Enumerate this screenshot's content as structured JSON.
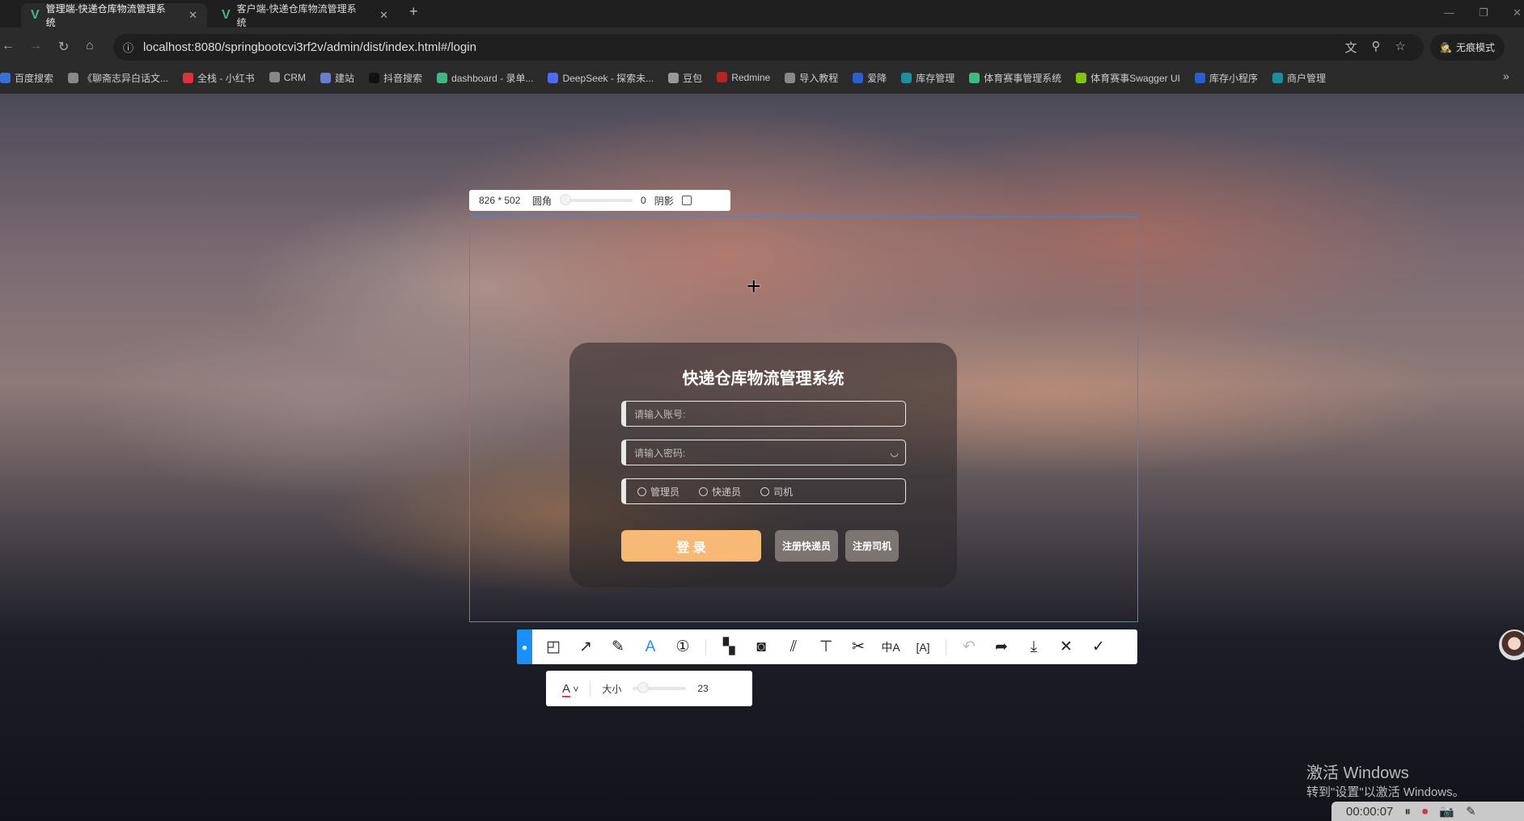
{
  "browser": {
    "tabs": [
      {
        "title": "管理端-快递仓库物流管理系统",
        "active": true
      },
      {
        "title": "客户端-快递仓库物流管理系统",
        "active": false
      }
    ],
    "url": "localhost:8080/springbootcvi3rf2v/admin/dist/index.html#/login",
    "incognito": "无痕模式",
    "bookmarks": [
      {
        "label": "百度搜索",
        "color": "#3b6fd8"
      },
      {
        "label": "《聊斋志异白话文...",
        "color": "#888"
      },
      {
        "label": "全栈 - 小红书",
        "color": "#e0303a"
      },
      {
        "label": "CRM",
        "color": "#888"
      },
      {
        "label": "建站",
        "color": "#6a7bd0"
      },
      {
        "label": "抖音搜索",
        "color": "#111"
      },
      {
        "label": "dashboard - 录单...",
        "color": "#41b883"
      },
      {
        "label": "DeepSeek - 探索未...",
        "color": "#4d6bfe"
      },
      {
        "label": "豆包",
        "color": "#999"
      },
      {
        "label": "Redmine",
        "color": "#b22"
      },
      {
        "label": "导入教程",
        "color": "#888"
      },
      {
        "label": "爱降",
        "color": "#2a5fd0"
      },
      {
        "label": "库存管理",
        "color": "#1a8fa0"
      },
      {
        "label": "体育赛事管理系统",
        "color": "#41b883"
      },
      {
        "label": "体育赛事Swagger UI",
        "color": "#85c20a"
      },
      {
        "label": "库存小程序",
        "color": "#2a5fd0"
      },
      {
        "label": "商户管理",
        "color": "#1a8fa0"
      }
    ]
  },
  "screenshot": {
    "size": "826 * 502",
    "radius_label": "圆角",
    "radius_value": "0",
    "shadow_label": "阴影"
  },
  "login": {
    "title": "快递仓库物流管理系统",
    "account_placeholder": "请输入账号:",
    "password_placeholder": "请输入密码:",
    "roles": [
      "管理员",
      "快递员",
      "司机"
    ],
    "login_button": "登 录",
    "register_courier": "注册快递员",
    "register_driver": "注册司机",
    "accent": "#f8b977"
  },
  "toolbar": {
    "text_color_label": "A",
    "size_label": "大小",
    "size_value": "23"
  },
  "activation": {
    "title": "激活 Windows",
    "subtitle": "转到\"设置\"以激活 Windows。"
  },
  "recorder": {
    "time": "00:00:07"
  }
}
